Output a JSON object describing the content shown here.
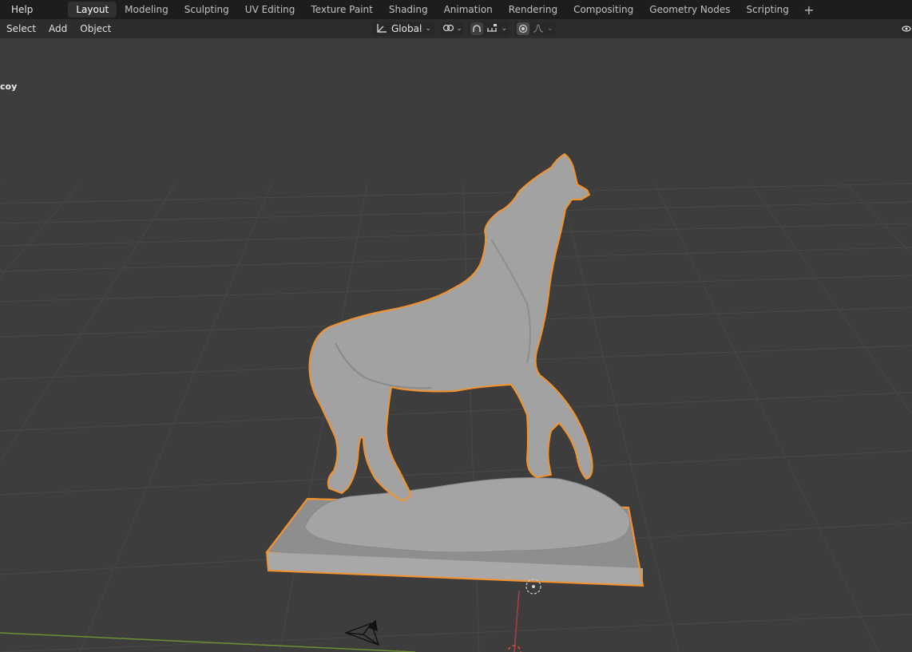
{
  "topbar": {
    "menu_help": "Help",
    "tabs": [
      {
        "label": "Layout",
        "active": true
      },
      {
        "label": "Modeling"
      },
      {
        "label": "Sculpting"
      },
      {
        "label": "UV Editing"
      },
      {
        "label": "Texture Paint"
      },
      {
        "label": "Shading"
      },
      {
        "label": "Animation"
      },
      {
        "label": "Rendering"
      },
      {
        "label": "Compositing"
      },
      {
        "label": "Geometry Nodes"
      },
      {
        "label": "Scripting"
      }
    ],
    "add_tab": "+"
  },
  "viewport_header": {
    "select": "Select",
    "add": "Add",
    "object": "Object",
    "orientation": "Global"
  },
  "viewport": {
    "object_label": "coy",
    "selection_color": "#f5922a",
    "model_color": "#9c9c9c",
    "background": "#3d3d3d",
    "x_axis_color": "#c2474f",
    "y_axis_color": "#7fa83c"
  }
}
